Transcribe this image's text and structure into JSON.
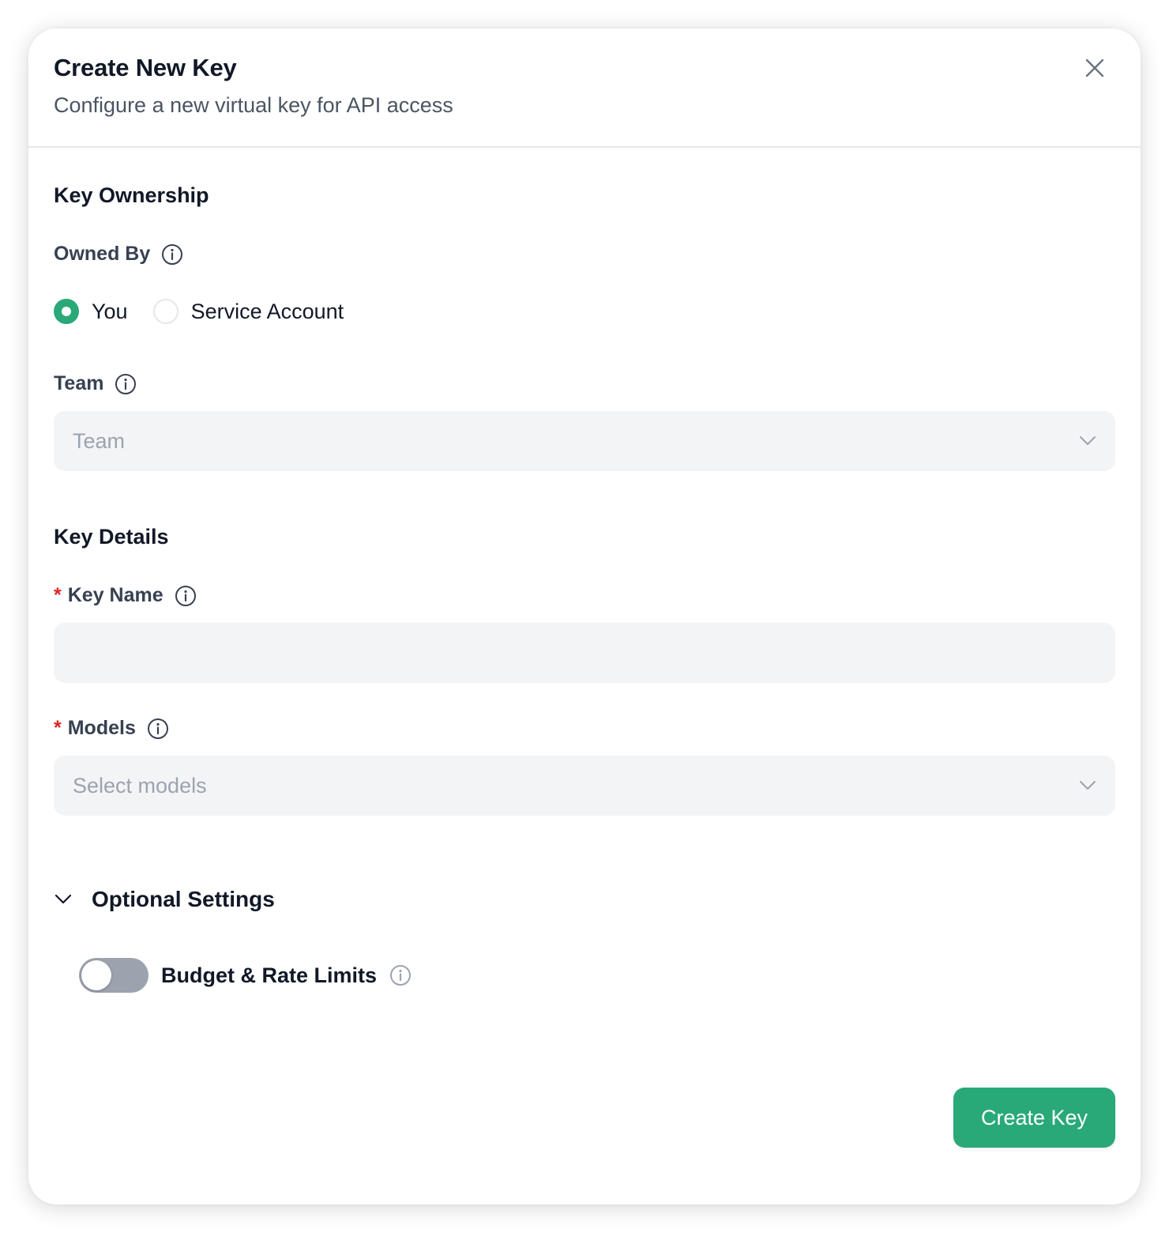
{
  "dialog": {
    "title": "Create New Key",
    "subtitle": "Configure a new virtual key for API access",
    "close_icon": "close-icon"
  },
  "ownership": {
    "section_title": "Key Ownership",
    "owned_by_label": "Owned By",
    "options": [
      {
        "label": "You",
        "selected": true
      },
      {
        "label": "Service Account",
        "selected": false
      }
    ],
    "team_label": "Team",
    "team_placeholder": "Team"
  },
  "details": {
    "section_title": "Key Details",
    "required_marker": "*",
    "key_name_label": "Key Name",
    "key_name_value": "",
    "models_label": "Models",
    "models_placeholder": "Select models"
  },
  "optional": {
    "title": "Optional Settings",
    "expanded": true,
    "budget_label": "Budget & Rate Limits",
    "budget_enabled": false
  },
  "actions": {
    "create_label": "Create Key"
  },
  "colors": {
    "accent": "#2aa978",
    "required": "#dc2626",
    "field_bg": "#f3f4f6",
    "toggle_off": "#9ca3af"
  }
}
